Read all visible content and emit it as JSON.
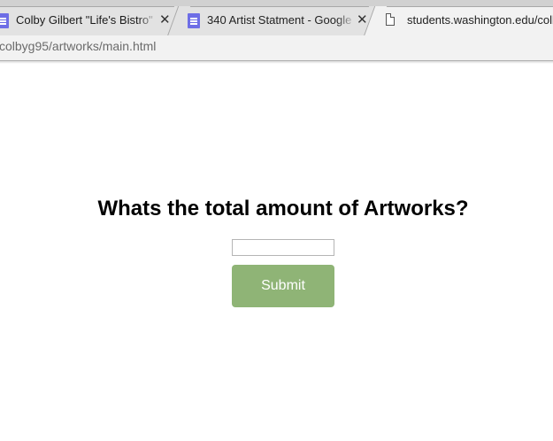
{
  "browser": {
    "tabs": [
      {
        "title": "Colby Gilbert \"Life's Bistro\" -",
        "icon": "google-docs-icon",
        "close_label": "✕"
      },
      {
        "title": "340 Artist Statment - Google",
        "icon": "google-docs-icon",
        "close_label": "✕"
      },
      {
        "title": "students.washington.edu/colb",
        "icon": "page-icon"
      }
    ],
    "url": "colbyg95/artworks/main.html"
  },
  "page": {
    "question": "Whats the total amount of Artworks?",
    "input_value": "",
    "submit_label": "Submit"
  },
  "colors": {
    "submit_button": "#8fb476",
    "docs_icon": "#6e6ee6"
  }
}
